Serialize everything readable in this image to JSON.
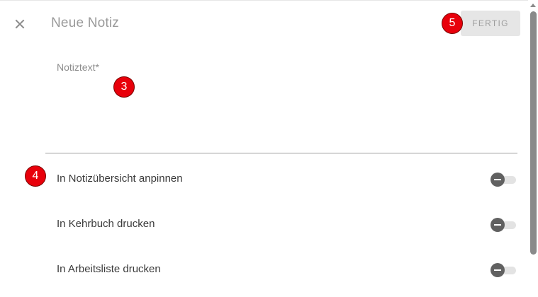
{
  "dialog": {
    "title": "Neue Notiz",
    "done_label": "FERTIG"
  },
  "note": {
    "label": "Notiztext*",
    "value": ""
  },
  "toggles": [
    {
      "label": "In Notizübersicht anpinnen",
      "state": "off"
    },
    {
      "label": "In Kehrbuch drucken",
      "state": "off"
    },
    {
      "label": "In Arbeitsliste drucken",
      "state": "off"
    }
  ],
  "markers": {
    "done": "5",
    "note": "3",
    "toggles": "4"
  },
  "icons": {
    "close": "close-icon"
  },
  "colors": {
    "marker": "#e8000b",
    "switch_thumb": "#616161",
    "done_button_bg": "#e6e6e6"
  }
}
